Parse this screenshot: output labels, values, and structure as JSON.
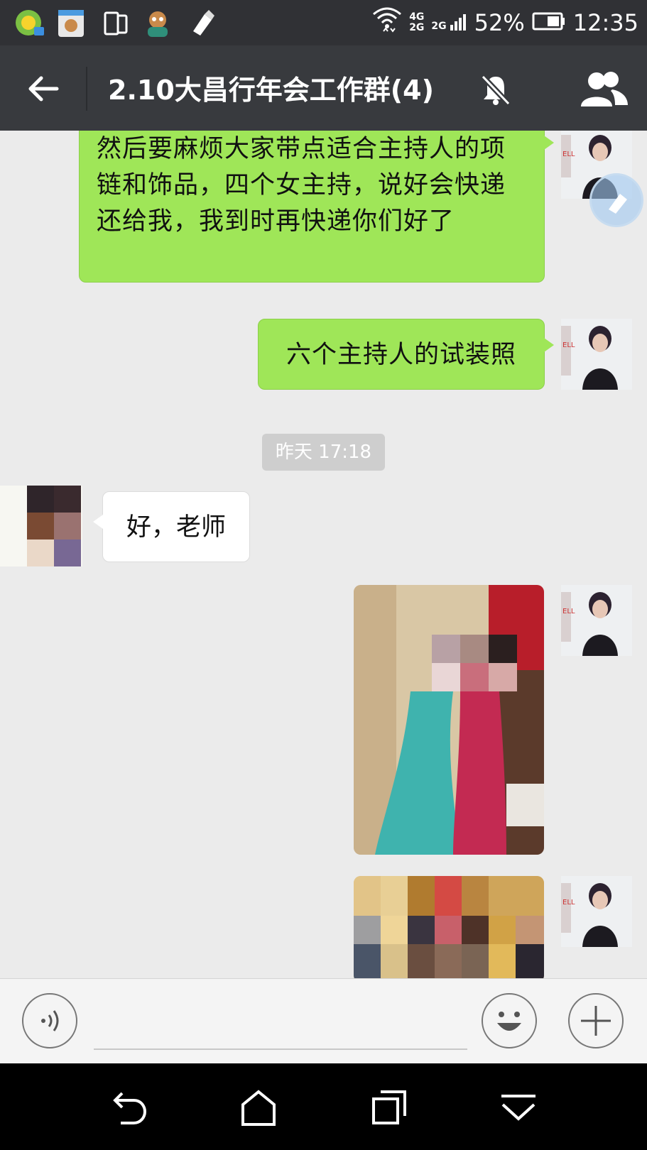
{
  "status_bar": {
    "network_top": "4G",
    "network_bottom": "2G",
    "network2": "2G",
    "battery": "52%",
    "time": "12:35"
  },
  "header": {
    "title": "2.10大昌行年会工作群(4)",
    "icons": [
      "back-icon",
      "mute-icon",
      "group-members-icon"
    ]
  },
  "messages": [
    {
      "sender": "me",
      "text": "然后要麻烦大家带点适合主持人的项链和饰品，四个女主持，说好会快递还给我，我到时再快递你们好了"
    },
    {
      "sender": "me",
      "text": "六个主持人的试装照"
    },
    {
      "type": "time",
      "text": "昨天 17:18"
    },
    {
      "sender": "other",
      "text": "好，老师"
    },
    {
      "sender": "me",
      "type": "image"
    },
    {
      "sender": "me",
      "type": "image"
    }
  ],
  "input_bar": {
    "icons": [
      "voice-icon",
      "emoji-icon",
      "plus-icon"
    ]
  },
  "colors": {
    "my_bubble": "#9fe658",
    "title_bar": "#383a3e",
    "status_bar": "#303135",
    "chat_bg": "#ebebeb"
  }
}
